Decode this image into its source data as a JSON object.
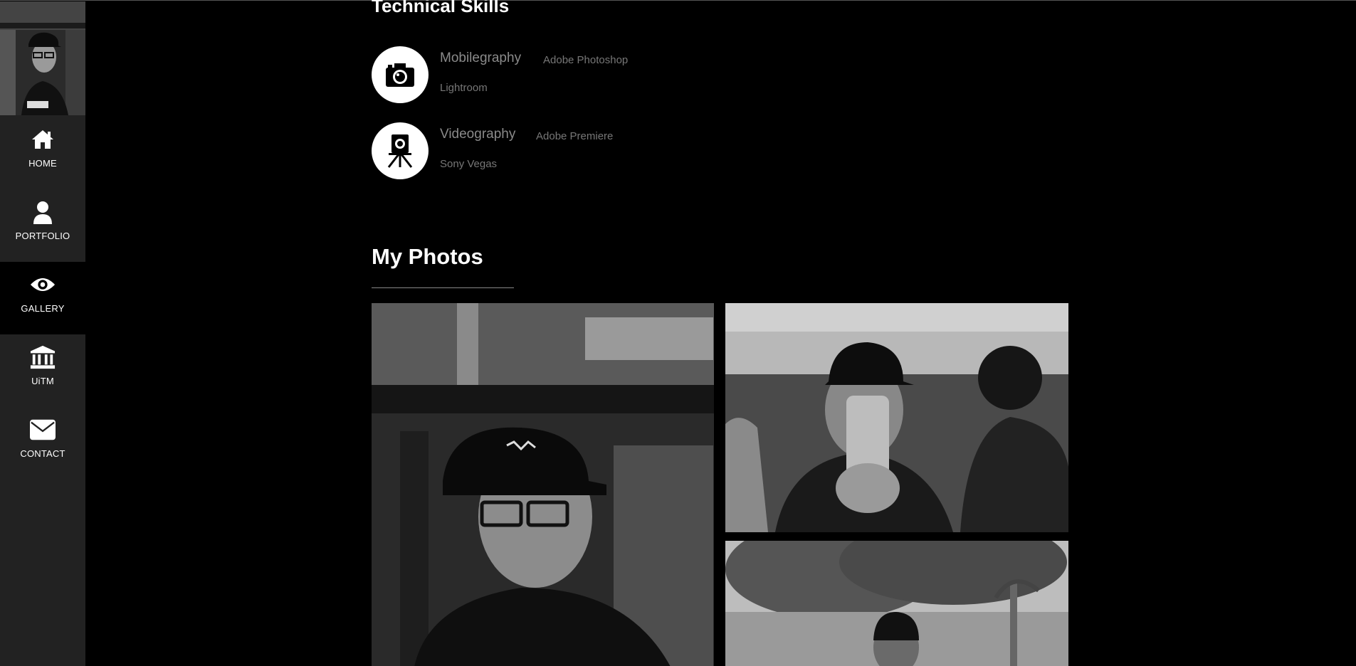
{
  "sidebar": {
    "items": [
      {
        "label": "HOME",
        "icon": "home-icon"
      },
      {
        "label": "PORTFOLIO",
        "icon": "user-icon"
      },
      {
        "label": "GALLERY",
        "icon": "eye-icon",
        "active": true
      },
      {
        "label": "UiTM",
        "icon": "institution-icon"
      },
      {
        "label": "CONTACT",
        "icon": "envelope-icon"
      }
    ]
  },
  "skills": {
    "title": "Technical Skills",
    "items": [
      {
        "name": "Mobilegraphy",
        "icon": "camera-icon",
        "tools": [
          "Adobe Photoshop",
          "Lightroom"
        ]
      },
      {
        "name": "Videography",
        "icon": "video-camera-tripod-icon",
        "tools": [
          "Adobe Premiere",
          "Sony Vegas"
        ]
      }
    ]
  },
  "photos": {
    "title": "My Photos"
  },
  "colors": {
    "sidebar_bg": "#222222",
    "page_bg": "#000000",
    "muted_text": "#8a8a8a"
  }
}
